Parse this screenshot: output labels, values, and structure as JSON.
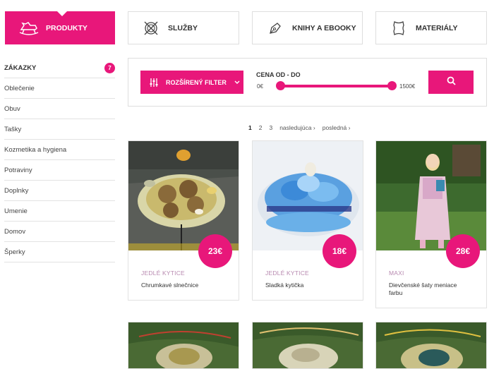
{
  "tabs": [
    {
      "label": "PRODUKTY",
      "icon": "rocking-horse-icon"
    },
    {
      "label": "SLUŽBY",
      "icon": "yarn-ball-icon"
    },
    {
      "label": "KNIHY A EBOOKY",
      "icon": "pen-nib-icon"
    },
    {
      "label": "MATERIÁLY",
      "icon": "leather-hide-icon"
    }
  ],
  "sidebar": {
    "heading": "ZÁKAZKY",
    "badge": "7",
    "items": [
      "Oblečenie",
      "Obuv",
      "Tašky",
      "Kozmetika a hygiena",
      "Potraviny",
      "Doplnky",
      "Umenie",
      "Domov",
      "Šperky"
    ]
  },
  "filter": {
    "button_label": "ROZŠÍRENÝ FILTER",
    "price_label": "CENA OD - DO",
    "min": "0€",
    "max": "1500€",
    "range_low": 0,
    "range_high": 1500
  },
  "pagination": {
    "pages": [
      "1",
      "2",
      "3"
    ],
    "current": "1",
    "next": "nasledujúca ›",
    "last": "posledná ›"
  },
  "products": [
    {
      "price": "23€",
      "category": "JEDLÉ KYTICE",
      "name": "Chrumkavé slnečnice"
    },
    {
      "price": "18€",
      "category": "JEDLÉ KYTICE",
      "name": "Sladká kytička"
    },
    {
      "price": "28€",
      "category": "MAXI",
      "name": "Dievčenské šaty meniace farbu"
    }
  ],
  "colors": {
    "accent": "#e8177a",
    "category": "#b88ab0"
  }
}
